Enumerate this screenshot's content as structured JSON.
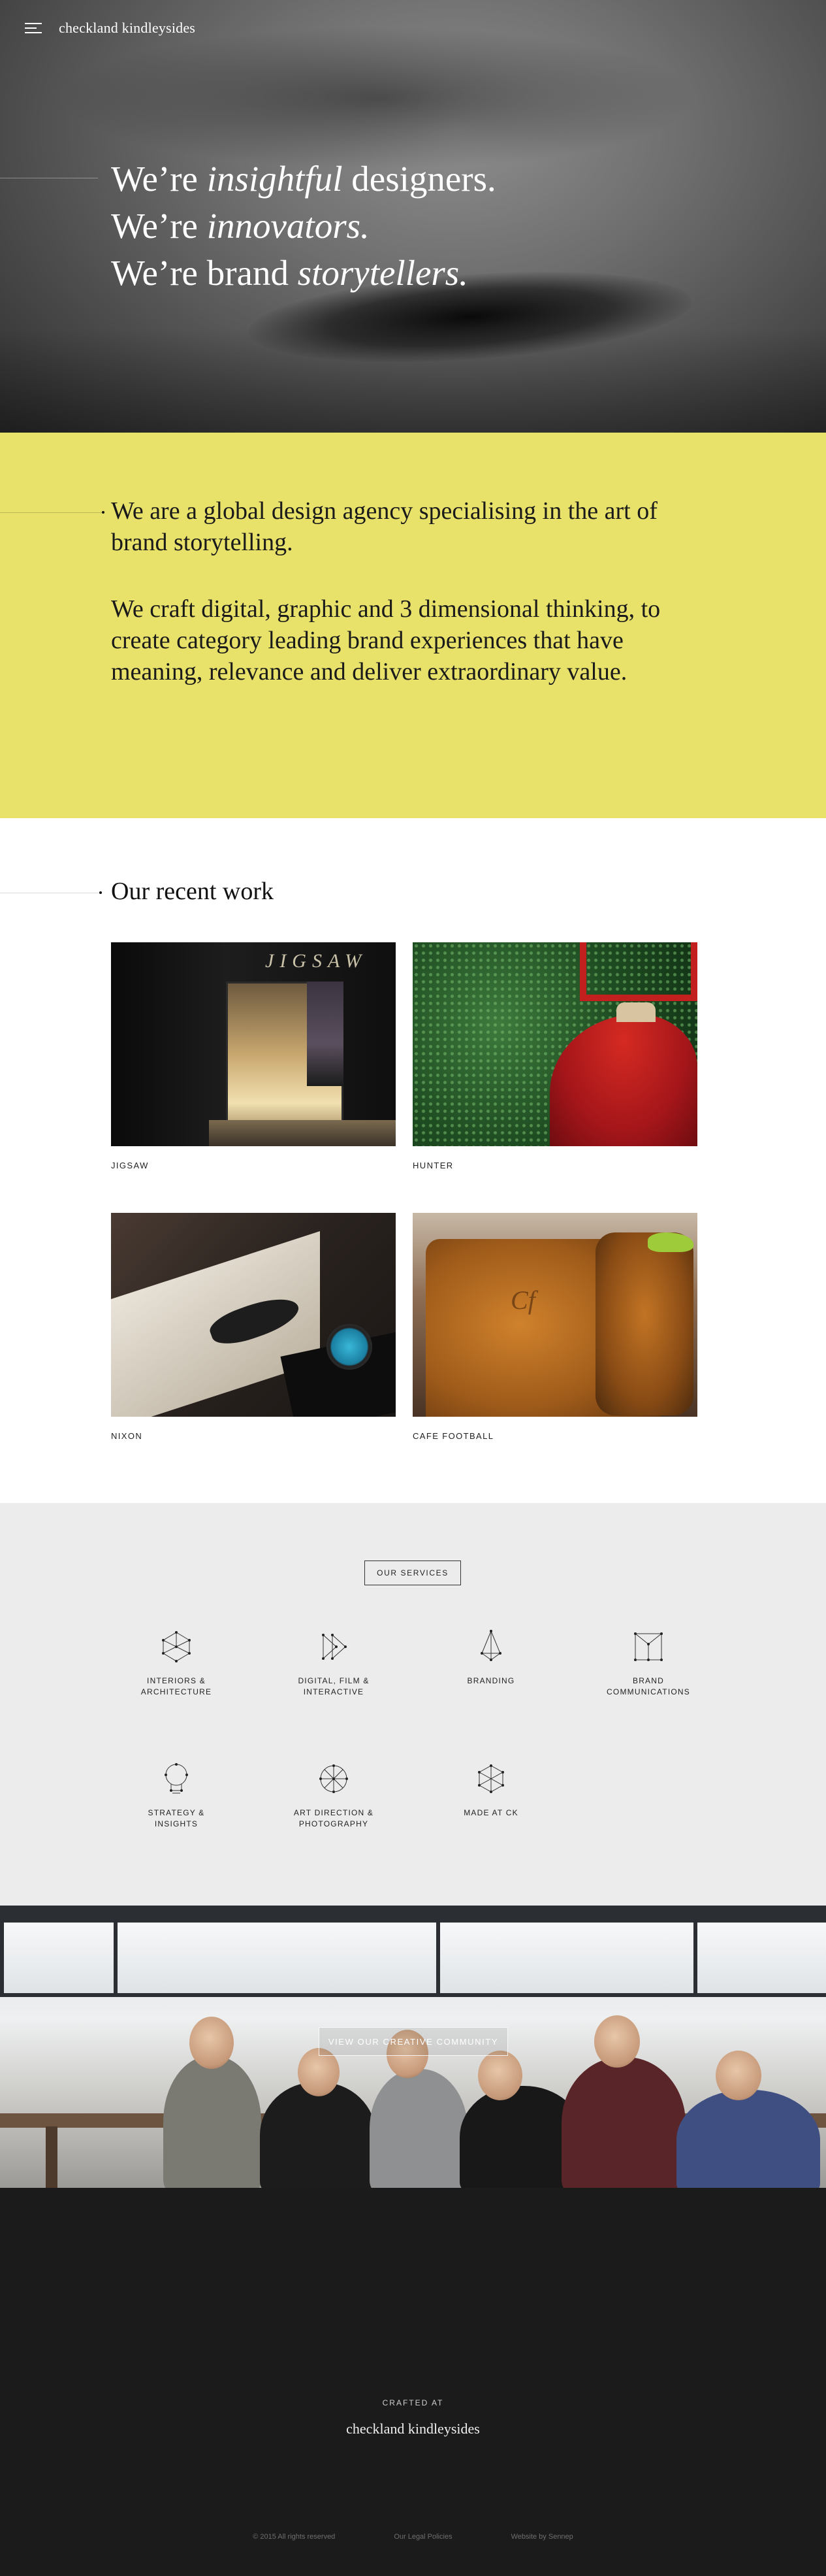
{
  "brand": {
    "logo": "checkland kindleysides"
  },
  "hero": {
    "line1_a": "We’re ",
    "line1_em": "insightful",
    "line1_b": " designers.",
    "line2_a": "We’re ",
    "line2_em": "innovators.",
    "line3_a": "We’re brand ",
    "line3_em": "storytellers."
  },
  "intro": {
    "p1": "We are a global design agency specialising in the art of brand storytelling.",
    "p2": "We craft digital, graphic and 3 dimensional thinking, to create category leading brand experiences that have meaning, relevance and deliver extraordinary value."
  },
  "work": {
    "title": "Our recent work",
    "items": [
      {
        "caption": "JIGSAW",
        "sign": "JIGSAW"
      },
      {
        "caption": "HUNTER"
      },
      {
        "caption": "NIXON"
      },
      {
        "caption": "CAFE FOOTBALL",
        "mark": "Cf"
      }
    ]
  },
  "services": {
    "button": "OUR SERVICES",
    "items": [
      {
        "line1": "INTERIORS &",
        "line2": "ARCHITECTURE",
        "icon": "cube-constellation-icon"
      },
      {
        "line1": "DIGITAL, FILM &",
        "line2": "INTERACTIVE",
        "icon": "play-constellation-icon"
      },
      {
        "line1": "BRANDING",
        "line2": "",
        "icon": "diamond-constellation-icon"
      },
      {
        "line1": "BRAND",
        "line2": "COMMUNICATIONS",
        "icon": "square-constellation-icon"
      },
      {
        "line1": "STRATEGY &",
        "line2": "INSIGHTS",
        "icon": "bulb-constellation-icon"
      },
      {
        "line1": "ART DIRECTION &",
        "line2": "PHOTOGRAPHY",
        "icon": "grid-constellation-icon"
      },
      {
        "line1": "MADE AT CK",
        "line2": "",
        "icon": "hexagon-constellation-icon"
      }
    ]
  },
  "team": {
    "button": "VIEW OUR CREATIVE COMMUNITY"
  },
  "footer": {
    "crafted": "CRAFTED AT",
    "logo": "checkland kindleysides",
    "copyright": "© 2015 All rights reserved",
    "legal": "Our Legal Policies",
    "credit": "Website by Sennep"
  },
  "colors": {
    "accent_yellow": "#e8e26b",
    "services_bg": "#ececec",
    "footer_bg": "#1b1b1b"
  }
}
